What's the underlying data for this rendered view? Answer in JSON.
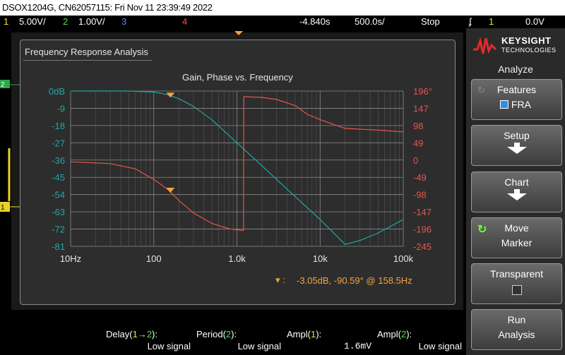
{
  "title_bar": "DSOX1204G, CN62057115: Fri Nov 11 23:39:49 2022",
  "status": {
    "ch1_num": "1",
    "ch1_scale": "5.00V/",
    "ch2_num": "2",
    "ch2_scale": "1.00V/",
    "ch3_num": "3",
    "ch4_num": "4",
    "delay": "-4.840s",
    "timebase": "500.0s/",
    "run_state": "Stop",
    "trig_src": "1",
    "trig_level": "0.0V"
  },
  "panel": {
    "title": "Frequency Response Analysis"
  },
  "chart_data": {
    "type": "line",
    "title": "Gain, Phase vs. Frequency",
    "x_scale": "log",
    "xlim": [
      10,
      100000
    ],
    "x_tick_labels": [
      "10Hz",
      "100",
      "1.0k",
      "10k",
      "100k"
    ],
    "gain_axis": {
      "ylim": [
        -81,
        0
      ],
      "tick_labels": [
        "0dB",
        "-9",
        "-18",
        "-27",
        "-36",
        "-45",
        "-54",
        "-63",
        "-72",
        "-81"
      ]
    },
    "phase_axis": {
      "ylim": [
        -245,
        196
      ],
      "tick_labels": [
        "196°",
        "147",
        "98",
        "49",
        "0",
        "-49",
        "-98",
        "-147",
        "-196",
        "-245"
      ]
    },
    "series": [
      {
        "color": "#1fa9a3",
        "axis": "gain",
        "x": [
          10,
          50,
          100,
          150,
          200,
          300,
          500,
          1000,
          2000,
          5000,
          10000,
          20000,
          30000,
          50000,
          100000
        ],
        "values": [
          0,
          0,
          -0.5,
          -2,
          -4,
          -8,
          -15,
          -27,
          -39,
          -55,
          -67,
          -80,
          -78,
          -74,
          -67
        ]
      },
      {
        "color": "#e8554a",
        "axis": "phase",
        "x": [
          10,
          30,
          60,
          100,
          150,
          200,
          300,
          500,
          800,
          1200,
          1210,
          2000,
          3000,
          5000,
          7000,
          10000,
          15000,
          20000,
          50000,
          100000
        ],
        "values": [
          -5,
          -10,
          -25,
          -55,
          -85,
          -115,
          -150,
          -180,
          -195,
          -200,
          180,
          178,
          172,
          155,
          130,
          115,
          100,
          90,
          85,
          80
        ]
      }
    ],
    "markers": [
      {
        "axis": "gain",
        "x": 158.5,
        "y": -3.05
      },
      {
        "axis": "phase",
        "x": 158.5,
        "y": -90.59
      }
    ],
    "readout": "-3.05dB, -90.59° @ 158.5Hz"
  },
  "sidebar": {
    "brand_name": "KEYSIGHT",
    "brand_sub": "TECHNOLOGIES",
    "header": "Analyze",
    "features_label": "Features",
    "fra_label": "FRA",
    "setup_label": "Setup",
    "chart_label": "Chart",
    "move_label": "Move",
    "marker_label": "Marker",
    "transparent_label": "Transparent",
    "run_label": "Run",
    "analysis_label": "Analysis"
  },
  "measurements": [
    {
      "title_pre": "Delay(",
      "title_mid": "1",
      "title_arrow": "→",
      "title_mid2": "2",
      "title_post": "):",
      "value": "Low signal"
    },
    {
      "title_pre": "Period(",
      "title_mid": "2",
      "title_post": "):",
      "value": "Low signal"
    },
    {
      "title_pre": "Ampl(",
      "title_mid": "1",
      "title_post": "):",
      "value": "1.6mV"
    },
    {
      "title_pre": "Ampl(",
      "title_mid": "2",
      "title_post": "):",
      "value": "Low signal"
    }
  ],
  "colors": {
    "ch1": "#f4e13a",
    "ch2": "#4fe04f",
    "ch3": "#5b8cff",
    "ch4": "#ff4b4b",
    "gain": "#1fa9a3",
    "phase": "#e8554a",
    "marker": "#f5a340"
  }
}
